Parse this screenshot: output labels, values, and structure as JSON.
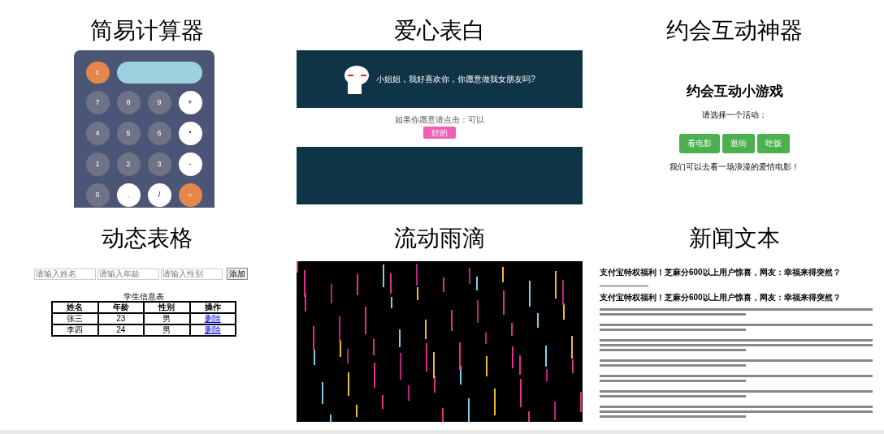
{
  "demos": [
    {
      "kind": "calculator",
      "title": "简易计算器",
      "keys": [
        {
          "label": "c",
          "kind": "clear"
        },
        {
          "label": "7",
          "kind": "number"
        },
        {
          "label": "8",
          "kind": "number"
        },
        {
          "label": "9",
          "kind": "number"
        },
        {
          "label": "+",
          "kind": "operator"
        },
        {
          "label": "4",
          "kind": "number"
        },
        {
          "label": "5",
          "kind": "number"
        },
        {
          "label": "6",
          "kind": "number"
        },
        {
          "label": "*",
          "kind": "operator"
        },
        {
          "label": "1",
          "kind": "number"
        },
        {
          "label": "2",
          "kind": "number"
        },
        {
          "label": "3",
          "kind": "number"
        },
        {
          "label": "-",
          "kind": "operator"
        },
        {
          "label": "0",
          "kind": "number"
        },
        {
          "label": ".",
          "kind": "operator"
        },
        {
          "label": "/",
          "kind": "operator"
        },
        {
          "label": "=",
          "kind": "equals"
        }
      ]
    },
    {
      "kind": "love",
      "title": "爱心表白",
      "message": "小姐姐，我好喜欢你，你愿意做我女朋友吗?",
      "prompt": "如果你愿意请点击：可以",
      "button": "好的"
    },
    {
      "kind": "dating",
      "title": "约会互动神器",
      "heading": "约会互动小游戏",
      "prompt": "请选择一个活动：",
      "options": [
        "看电影",
        "逛街",
        "吃饭"
      ],
      "result": "我们可以去看一场浪漫的爱情电影！"
    },
    {
      "kind": "table",
      "title": "动态表格",
      "placeholders": [
        "请输入姓名",
        "请输入年龄",
        "请输入性别"
      ],
      "add_button": "添加",
      "caption": "学生信息表",
      "columns": [
        "姓名",
        "年龄",
        "性别",
        "操作"
      ],
      "rows": [
        [
          "张三",
          "23",
          "男",
          "删除"
        ],
        [
          "李四",
          "24",
          "男",
          "删除"
        ]
      ]
    },
    {
      "kind": "rain",
      "title": "流动雨滴"
    },
    {
      "kind": "news",
      "title": "新闻文本",
      "headline": "支付宝特权福利！芝麻分600以上用户惊喜，网友：幸福来得突然？",
      "subheading": "支付宝特权福利！芝麻分600以上用户惊喜，网友：幸福来得突然？"
    }
  ]
}
